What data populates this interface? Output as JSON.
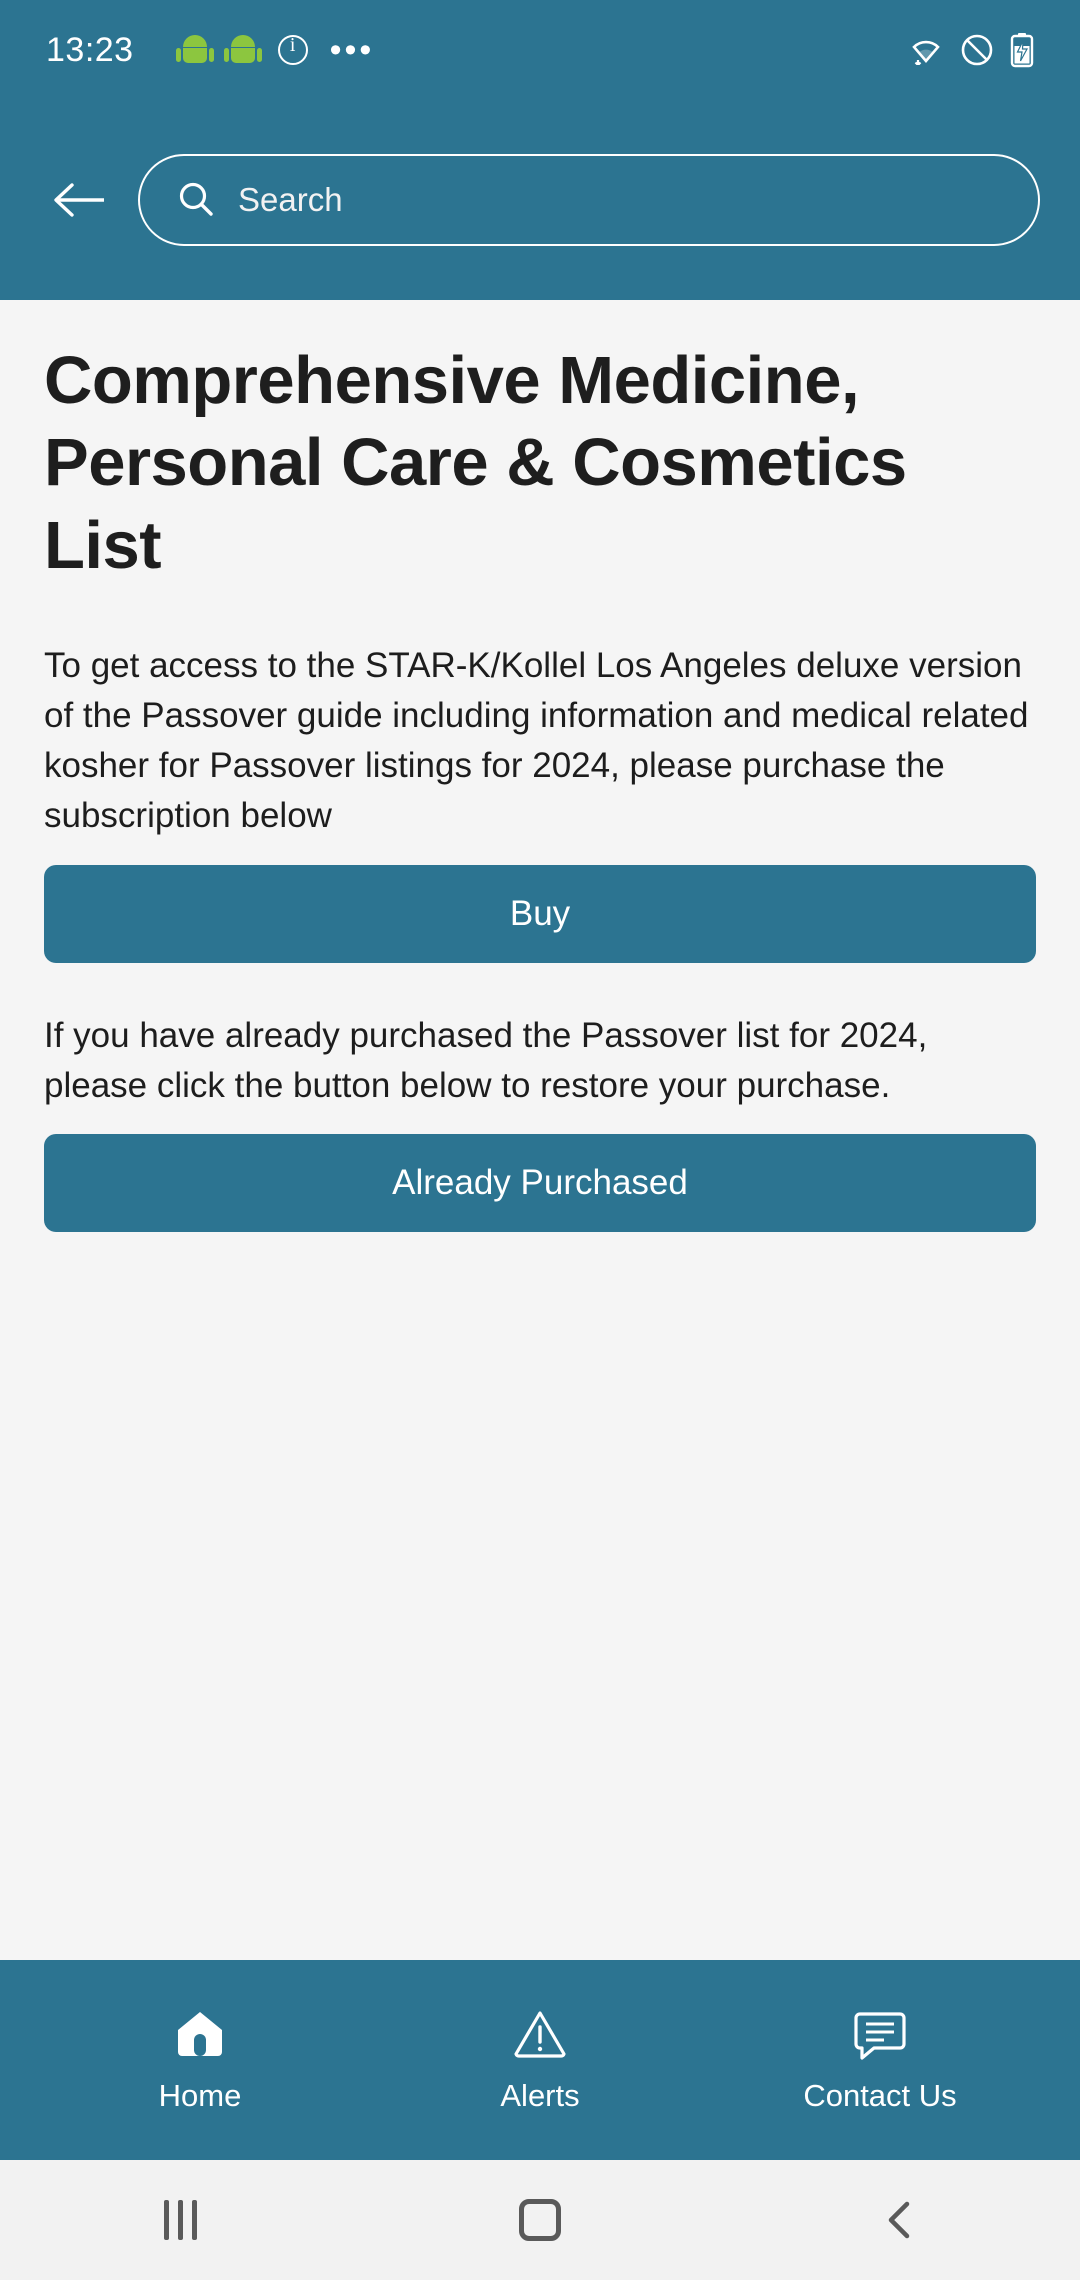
{
  "status_bar": {
    "time": "13:23",
    "left_icons": [
      "android-robot-icon",
      "android-robot-icon",
      "info-circle-icon",
      "more-dots-icon"
    ],
    "right_icons": [
      "wifi-icon",
      "notifications-off-icon",
      "battery-charging-icon"
    ]
  },
  "app_bar": {
    "back_icon": "back-arrow-icon",
    "search_placeholder": "Search"
  },
  "main": {
    "title": "Comprehensive Medicine, Personal Care & Cosmetics List",
    "paragraph_1": "To get access to the STAR-K/Kollel Los Angeles deluxe version of the Passover guide including information and medical related kosher for Passover listings for 2024, please purchase the subscription below",
    "buy_button": "Buy",
    "paragraph_2": "If you have already purchased the Passover list for 2024, please click the button below to restore your purchase.",
    "already_purchased_button": "Already Purchased"
  },
  "bottom_nav": {
    "items": [
      {
        "label": "Home",
        "icon": "home-icon"
      },
      {
        "label": "Alerts",
        "icon": "alert-triangle-icon"
      },
      {
        "label": "Contact Us",
        "icon": "chat-bubble-icon"
      }
    ]
  },
  "system_nav": {
    "recents": "recents-icon",
    "home": "home-square-icon",
    "back": "back-chevron-icon"
  },
  "colors": {
    "brand": "#2c7491",
    "page_bg": "#f5f5f5",
    "text": "#1d1d1d"
  }
}
